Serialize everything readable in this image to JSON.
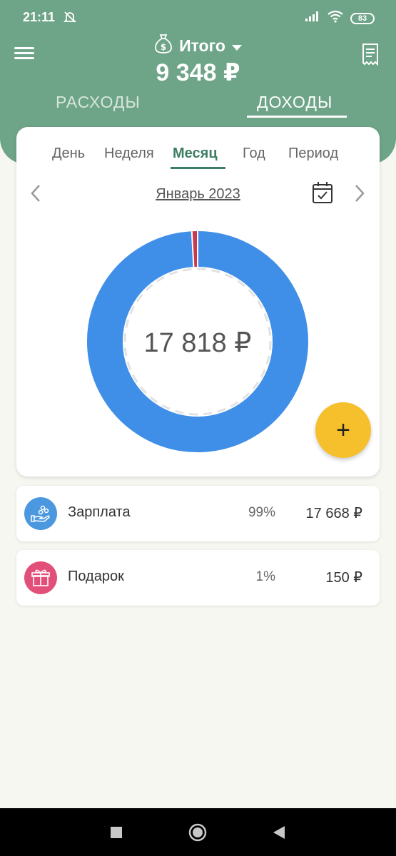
{
  "status": {
    "time": "21:11",
    "battery": "83"
  },
  "header": {
    "account_label": "Итого",
    "total": "9 348 ₽",
    "tabs": [
      {
        "label": "РАСХОДЫ"
      },
      {
        "label": "ДОХОДЫ"
      }
    ],
    "active_tab": "ДОХОДЫ"
  },
  "period": {
    "tabs": [
      {
        "label": "День"
      },
      {
        "label": "Неделя"
      },
      {
        "label": "Месяц"
      },
      {
        "label": "Год"
      },
      {
        "label": "Период"
      }
    ],
    "active": "Месяц",
    "current": "Январь 2023"
  },
  "chart_data": {
    "type": "pie",
    "style": "donut",
    "categories": [
      "Зарплата",
      "Подарок"
    ],
    "values": [
      17668,
      150
    ],
    "percents": [
      99,
      1
    ],
    "colors": [
      "#3f8fe8",
      "#c9394f"
    ],
    "center_label": "17 818 ₽"
  },
  "fab": {
    "label": "+"
  },
  "categories": [
    {
      "name": "Зарплата",
      "percent": "99%",
      "amount": "17 668 ₽",
      "color": "#4b98e0"
    },
    {
      "name": "Подарок",
      "percent": "1%",
      "amount": "150 ₽",
      "color": "#e2507a"
    }
  ]
}
